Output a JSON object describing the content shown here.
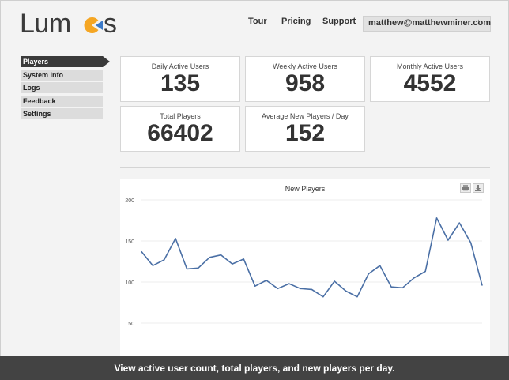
{
  "app": {
    "logo_text": "Lum",
    "logo_tail": "s"
  },
  "nav": {
    "tour": "Tour",
    "pricing": "Pricing",
    "support": "Support"
  },
  "account": {
    "email": "matthew@matthewminer.com",
    "menu_icon": "down-arrow-icon",
    "menu_glyph": "↓"
  },
  "sidebar": {
    "items": [
      {
        "label": "Players",
        "active": true
      },
      {
        "label": "System Info"
      },
      {
        "label": "Logs"
      },
      {
        "label": "Feedback"
      },
      {
        "label": "Settings"
      }
    ]
  },
  "stats": {
    "daily": {
      "label": "Daily Active Users",
      "value": "135"
    },
    "weekly": {
      "label": "Weekly Active Users",
      "value": "958"
    },
    "monthly": {
      "label": "Monthly Active Users",
      "value": "4552"
    },
    "total": {
      "label": "Total Players",
      "value": "66402"
    },
    "avg_new": {
      "label": "Average New Players / Day",
      "value": "152"
    }
  },
  "chart_data": {
    "type": "line",
    "title": "New Players",
    "xlabel": "",
    "ylabel": "",
    "ylim": [
      50,
      200
    ],
    "yticks": [
      50,
      100,
      150,
      200
    ],
    "grid": true,
    "series": [
      {
        "values": [
          137,
          120,
          127,
          153,
          116,
          117,
          130,
          133,
          122,
          128,
          95,
          102,
          92,
          98,
          92,
          91,
          82,
          101,
          89,
          82,
          110,
          120,
          94,
          93,
          105,
          113,
          178,
          151,
          172,
          148,
          96
        ]
      }
    ],
    "color": "#4a6fa5"
  },
  "chart_buttons": {
    "print_icon": "print-icon",
    "download_icon": "download-icon"
  },
  "caption": "View active user count, total players, and new players per day."
}
